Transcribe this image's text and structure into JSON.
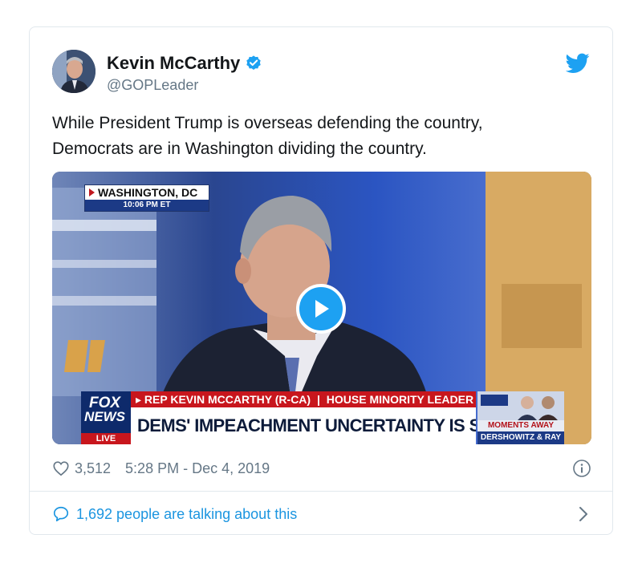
{
  "author": {
    "name": "Kevin McCarthy",
    "handle": "@GOPLeader",
    "verified": true
  },
  "tweet": {
    "lines": [
      "While President Trump is overseas defending the country,",
      "Democrats are in Washington dividing the country."
    ]
  },
  "media": {
    "type": "video",
    "location": "WASHINGTON, DC",
    "location_time": "10:06 PM ET",
    "network_lines": [
      "FOX",
      "NEWS",
      "LIVE"
    ],
    "strap_name": "REP KEVIN MCCARTHY (R-CA)",
    "strap_title": "HOUSE MINORITY LEADER",
    "headline": "DEMS' IMPEACHMENT UNCERTAINTY IS SCARING THE LEFT",
    "side_promo": "MOMENTS AWAY",
    "side_names": "DERSHOWITZ & RAY"
  },
  "footer": {
    "likes": "3,512",
    "timestamp": "5:28 PM - Dec 4, 2019",
    "talking": "1,692 people are talking about this"
  },
  "colors": {
    "twitter_blue": "#1da1f2",
    "link_blue": "#1b95e0",
    "muted": "#657786",
    "fox_red": "#c8161d",
    "fox_navy": "#0e2a6b"
  }
}
